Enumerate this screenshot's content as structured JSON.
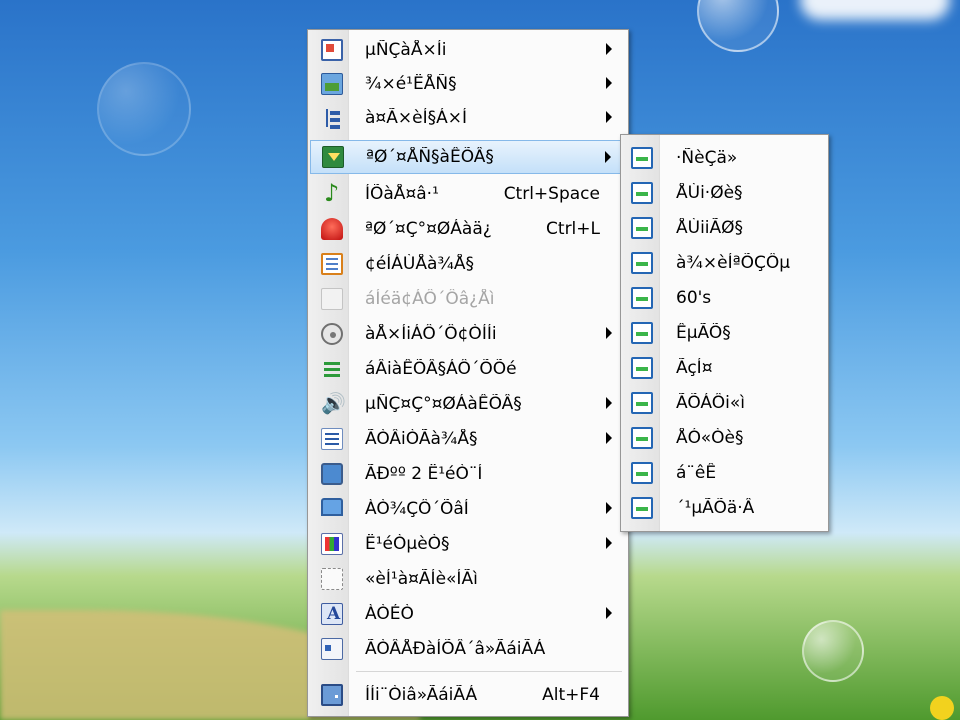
{
  "colors": {
    "menu_bg": "#fbfbfb",
    "highlight": "#c4e0f9",
    "highlight_border": "#86b9e9",
    "disabled_text": "#a5a5a5"
  },
  "main_menu": {
    "items": [
      {
        "label": "µÑÇàÅ×Íi",
        "icon": "window-icon",
        "submenu": true
      },
      {
        "label": "¾×é¹ËÅÑ§",
        "icon": "picture-icon",
        "submenu": true
      },
      {
        "label": "à¤Ã×èÍ§Á×Í",
        "icon": "tree-icon",
        "submenu": true
      },
      {
        "label": "ªØ´¤ÅÑ§àÊÕÂ§",
        "icon": "install-icon",
        "submenu": true,
        "highlighted": true
      },
      {
        "label": "ÍÕàÅ¤â·¹",
        "icon": "music-note-icon",
        "shortcut": "Ctrl+Space"
      },
      {
        "label": "ªØ´¤Ç°¤ØÁàä¿",
        "icon": "alarm-icon",
        "shortcut": "Ctrl+L"
      },
      {
        "label": "¢éÍÁÙÅà¾Å§",
        "icon": "spreadsheet-icon"
      },
      {
        "label": "áÍéä¢ÁÔ´Ôâ¿Åì",
        "icon": "document-icon",
        "disabled": true
      },
      {
        "label": "àÅ×ÍiÁÔ´Ô¢ÒÍÍi",
        "icon": "disc-icon",
        "submenu": true
      },
      {
        "label": "áÂiàÊÕÂ§ÁÔ´ÕÕé",
        "icon": "equalizer-icon"
      },
      {
        "label": "µÑÇ¤Ç°¤ØÁàÊÕÂ§",
        "icon": "speaker-icon",
        "submenu": true
      },
      {
        "label": "ÃÒÂiÒÃà¾Å§",
        "icon": "playlist-icon",
        "submenu": true
      },
      {
        "label": "ÃÐºº 2 Ë¹éÒ¨Í",
        "icon": "dual-monitor-icon"
      },
      {
        "label": "ÀÒ¾ÇÔ´ÕâÍ",
        "icon": "monitor-icon",
        "submenu": true
      },
      {
        "label": "Ë¹éÒµèÒ§",
        "icon": "palette-icon",
        "submenu": true
      },
      {
        "label": "«èÍ¹à¤ÃÍè«ÍÃì",
        "icon": "hide-icon"
      },
      {
        "label": "ÀÒÉÒ",
        "icon": "font-icon",
        "submenu": true
      },
      {
        "label": "ÃÒÂÅÐàÍÕÂ´â»ÃáiÃÁ",
        "icon": "info-card-icon"
      },
      {
        "label": "ÍÍi¨Òiâ»ÃáiÃÁ",
        "icon": "exit-door-icon",
        "shortcut": "Alt+F4"
      }
    ]
  },
  "submenu": {
    "items": [
      {
        "label": "·ÑèÇä»"
      },
      {
        "label": "ÅÙi·Øè§"
      },
      {
        "label": "ÅÙiiÃØ§"
      },
      {
        "label": "à¾×èÍªÕÇÔµ"
      },
      {
        "label": "60's"
      },
      {
        "label": "ÊµÃÕ§"
      },
      {
        "label": "ÃçÍ¤"
      },
      {
        "label": "ÃÕÁÔi«ì"
      },
      {
        "label": "ÅÓ«Òè§"
      },
      {
        "label": "á¨êÊ"
      },
      {
        "label": "´¹µÃÕä·Â"
      }
    ]
  }
}
